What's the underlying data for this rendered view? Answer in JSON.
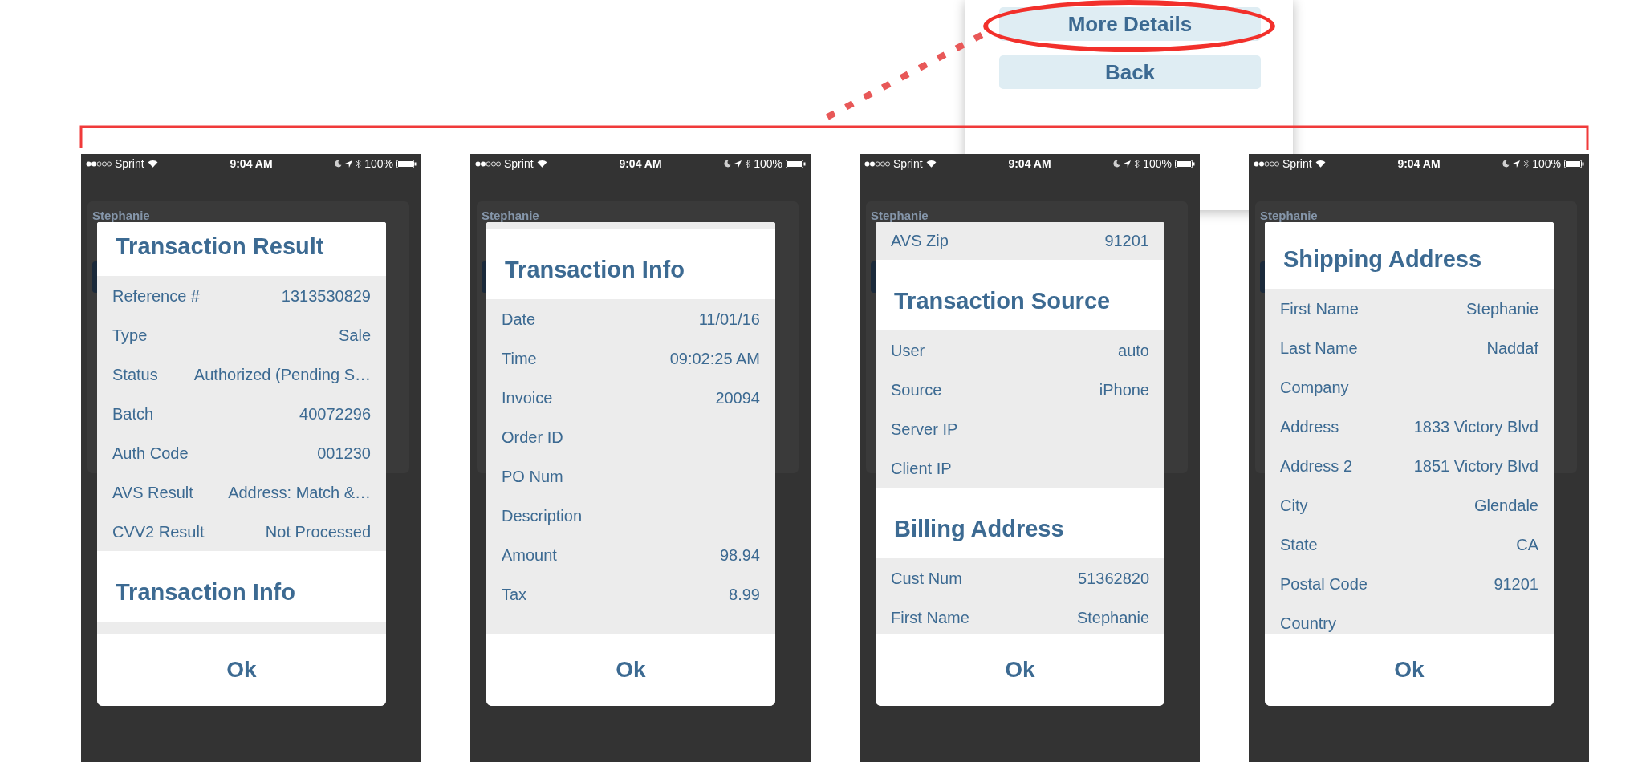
{
  "popup": {
    "buttons": [
      {
        "label": "More Details",
        "circled": true
      },
      {
        "label": "Back",
        "circled": false
      }
    ]
  },
  "screens": [
    {
      "status_bar": {
        "carrier": "Sprint",
        "time": "9:04 AM",
        "battery": "100%"
      },
      "background_name": "Stephanie",
      "dialog": {
        "sections": [
          {
            "title": "Transaction Result",
            "rows": [
              {
                "label": "Reference #",
                "value": "1313530829"
              },
              {
                "label": "Type",
                "value": "Sale"
              },
              {
                "label": "Status",
                "value": "Authorized (Pending S…"
              },
              {
                "label": "Batch",
                "value": "40072296"
              },
              {
                "label": "Auth Code",
                "value": "001230"
              },
              {
                "label": "AVS Result",
                "value": "Address: Match &…"
              },
              {
                "label": "CVV2 Result",
                "value": "Not Processed"
              }
            ]
          },
          {
            "title": "Transaction Info"
          }
        ],
        "ok_button": "Ok"
      }
    },
    {
      "status_bar": {
        "carrier": "Sprint",
        "time": "9:04 AM",
        "battery": "100%"
      },
      "background_name": "Stephanie",
      "dialog": {
        "sections": [
          {
            "title": "Transaction Info",
            "rows": [
              {
                "label": "Date",
                "value": "11/01/16"
              },
              {
                "label": "Time",
                "value": "09:02:25 AM"
              },
              {
                "label": "Invoice",
                "value": "20094"
              },
              {
                "label": "Order ID"
              },
              {
                "label": "PO Num"
              },
              {
                "label": "Description"
              },
              {
                "label": "Amount",
                "value": "98.94"
              },
              {
                "label": "Tax",
                "value": "8.99"
              }
            ]
          }
        ],
        "ok_button": "Ok"
      }
    },
    {
      "status_bar": {
        "carrier": "Sprint",
        "time": "9:04 AM",
        "battery": "100%"
      },
      "background_name": "Stephanie",
      "dialog": {
        "sections": [
          {
            "rows": [
              {
                "label": "AVS Zip",
                "value": "91201"
              }
            ]
          },
          {
            "title": "Transaction Source",
            "rows": [
              {
                "label": "User",
                "value": "auto"
              },
              {
                "label": "Source",
                "value": "iPhone"
              },
              {
                "label": "Server IP"
              },
              {
                "label": "Client IP"
              }
            ]
          },
          {
            "title": "Billing Address",
            "rows": [
              {
                "label": "Cust Num",
                "value": "51362820"
              },
              {
                "label": "First Name",
                "value": "Stephanie"
              }
            ]
          }
        ],
        "ok_button": "Ok"
      }
    },
    {
      "status_bar": {
        "carrier": "Sprint",
        "time": "9:04 AM",
        "battery": "100%"
      },
      "background_name": "Stephanie",
      "dialog": {
        "sections": [
          {
            "title": "Shipping Address",
            "rows": [
              {
                "label": "First Name",
                "value": "Stephanie"
              },
              {
                "label": "Last Name",
                "value": "Naddaf"
              },
              {
                "label": "Company"
              },
              {
                "label": "Address",
                "value": "1833 Victory Blvd"
              },
              {
                "label": "Address 2",
                "value": "1851 Victory Blvd"
              },
              {
                "label": "City",
                "value": "Glendale"
              },
              {
                "label": "State",
                "value": "CA"
              },
              {
                "label": "Postal Code",
                "value": "91201"
              },
              {
                "label": "Country"
              }
            ]
          }
        ],
        "ok_button": "Ok"
      }
    }
  ]
}
